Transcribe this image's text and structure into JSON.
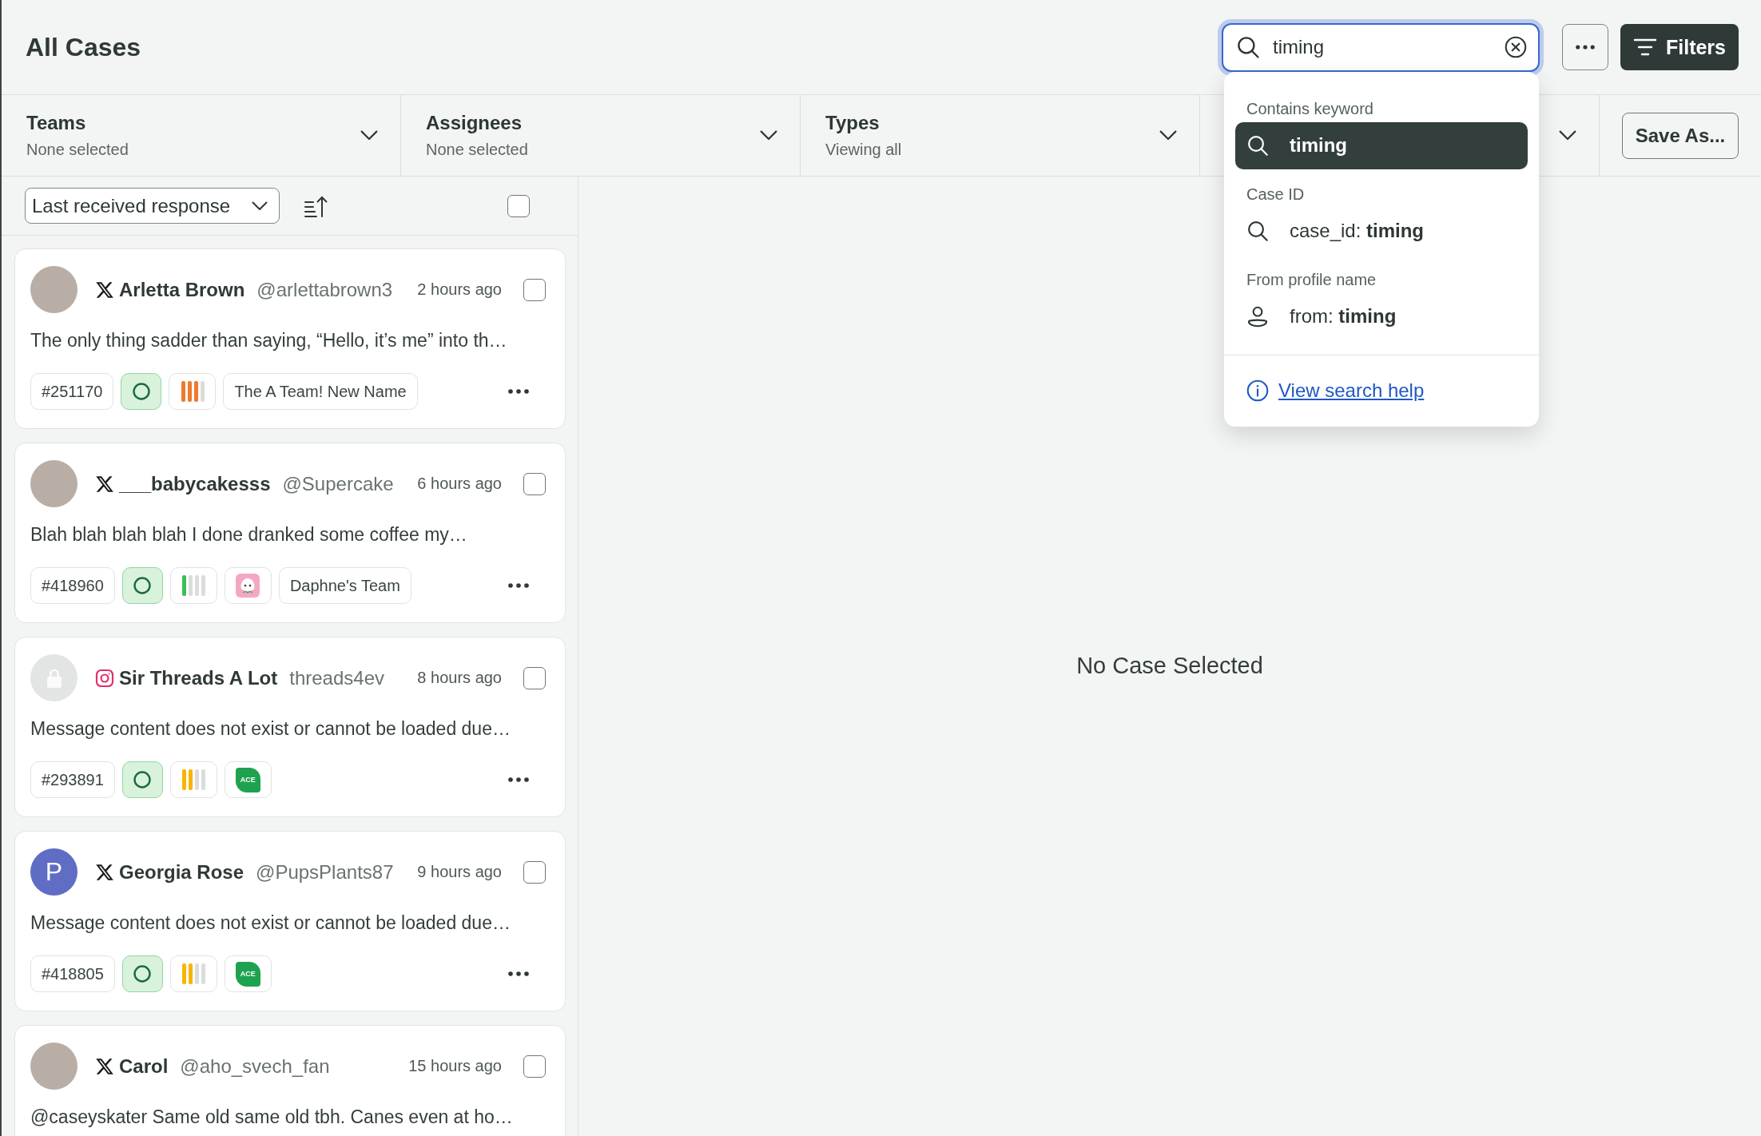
{
  "header": {
    "title": "All Cases",
    "search": {
      "value": "timing",
      "focused": true
    },
    "filters_button": "Filters"
  },
  "search_menu": {
    "groups": [
      {
        "heading": "Contains keyword",
        "items": [
          {
            "kind": "search",
            "label": "timing",
            "selected": true
          }
        ]
      },
      {
        "heading": "Case ID",
        "items": [
          {
            "kind": "search",
            "label": "case_id: **timing**",
            "selected": false
          }
        ]
      },
      {
        "heading": "From profile name",
        "items": [
          {
            "kind": "profile",
            "label": "from: **timing**",
            "selected": false
          }
        ]
      }
    ],
    "help_link": "View search help"
  },
  "filter_bar": {
    "filters": [
      {
        "label": "Teams",
        "value": "None selected"
      },
      {
        "label": "Assignees",
        "value": "None selected"
      },
      {
        "label": "Types",
        "value": "Viewing all"
      }
    ],
    "save_button": "Save As..."
  },
  "case_list": {
    "sort": "Last received response",
    "select_all": {
      "checked": false
    },
    "cases": [
      {
        "selected": false,
        "avatar": {
          "kind": "photo"
        },
        "platform": {
          "kind": "x"
        },
        "name": "Arletta Brown",
        "handle": "@arlettabrown3",
        "time": "2 hours ago",
        "checked": false,
        "message": "The only thing sadder than saying, “Hello, it’s me” into th…",
        "tags": [
          {
            "kind": "id",
            "label": "#251170"
          },
          {
            "kind": "status",
            "open": true
          },
          {
            "kind": "priority",
            "level": 0.75,
            "color": "#f07a2b"
          },
          {
            "kind": "team",
            "label": "The A Team! New Name"
          }
        ]
      },
      {
        "selected": false,
        "avatar": {
          "kind": "photo"
        },
        "platform": {
          "kind": "x"
        },
        "name": "___babycakesss",
        "handle": "@Supercake",
        "time": "6 hours ago",
        "checked": false,
        "message": "Blah blah blah blah I done dranked some coffee my…",
        "tags": [
          {
            "kind": "id",
            "label": "#418960"
          },
          {
            "kind": "status",
            "open": true
          },
          {
            "kind": "priority",
            "level": 0.25,
            "color": "#3bbf55"
          },
          {
            "kind": "team_sticker"
          },
          {
            "kind": "team",
            "label": "Daphne's Team"
          }
        ]
      },
      {
        "selected": false,
        "avatar": {
          "kind": "locked"
        },
        "platform": {
          "kind": "instagram"
        },
        "name": "Sir Threads A Lot",
        "handle": "threads4ev",
        "time": "8 hours ago",
        "checked": false,
        "message": "Message content does not exist or cannot be loaded due…",
        "tags": [
          {
            "kind": "id",
            "label": "#293891"
          },
          {
            "kind": "status",
            "open": true
          },
          {
            "kind": "priority",
            "level": 0.5,
            "color": "#f7b500"
          },
          {
            "kind": "team_logo",
            "label": "ACE"
          }
        ]
      },
      {
        "selected": false,
        "avatar": {
          "kind": "initial",
          "initial": "P"
        },
        "platform": {
          "kind": "x"
        },
        "name": "Georgia Rose",
        "handle": "@PupsPlants87",
        "time": "9 hours ago",
        "checked": false,
        "message": "Message content does not exist or cannot be loaded due…",
        "tags": [
          {
            "kind": "id",
            "label": "#418805"
          },
          {
            "kind": "status",
            "open": true
          },
          {
            "kind": "priority",
            "level": 0.5,
            "color": "#f7b500"
          },
          {
            "kind": "team_logo",
            "label": "ACE"
          }
        ]
      },
      {
        "selected": false,
        "avatar": {
          "kind": "photo"
        },
        "platform": {
          "kind": "x"
        },
        "name": "Carol",
        "handle": "@aho_svech_fan",
        "time": "15 hours ago",
        "checked": false,
        "message": "@caseyskater Same old same old tbh. Canes even at ho…"
      }
    ]
  },
  "detail": {
    "empty_message": "No Case Selected"
  }
}
